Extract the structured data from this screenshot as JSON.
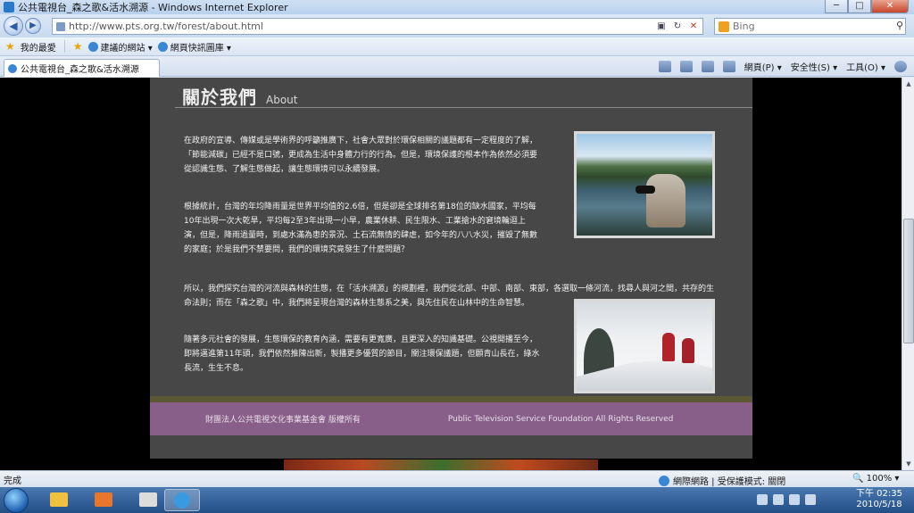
{
  "window": {
    "title": "公共電視台_森之歌&活水溯源 - Windows Internet Explorer",
    "minimize": "─",
    "maximize": "□",
    "close": "✕"
  },
  "address": {
    "url": "http://www.pts.org.tw/forest/about.html"
  },
  "search": {
    "placeholder": "Bing"
  },
  "favorites": {
    "label": "我的最愛",
    "items": [
      {
        "label": "建議的網站 ▾"
      },
      {
        "label": "網頁快訊圖庫 ▾"
      }
    ]
  },
  "tab": {
    "title": "公共電視台_森之歌&活水溯源"
  },
  "commands": {
    "page": "網頁(P) ▾",
    "safety": "安全性(S) ▾",
    "tools": "工具(O) ▾"
  },
  "page": {
    "heading_zh": "關於我們",
    "heading_en": "About",
    "paragraphs": [
      "在政府的宣導、傳媒或是學術界的呼籲推廣下，社會大眾對於環保相關的議題都有一定程度的了解，「節能減碳」已經不是口號，更成為生活中身體力行的行為。但是，環境保護的根本作為依然必須要從認識生態、了解生態做起，讓生態環境可以永續發展。",
      "根據統計，台灣的年均降雨量是世界平均值的2.6倍，但是卻是全球排名第18位的缺水國家，平均每10年出現一次大乾旱，平均每2至3年出現一小旱，農業休耕、民生限水、工業搶水的窘境輪迴上演，但是，降雨過量時，到處水滿為患的景況、土石流無情的肆虐，如今年的八八水災，摧毀了無數的家庭；於是我們不禁要問，我們的環境究竟發生了什麼問題？",
      "所以，我們探究台灣的河流與森林的生態，在「活水溯源」的規劃裡，我們從北部、中部、南部、東部，各選取一條河流，找尋人與河之間，共存的生命法則；而在「森之歌」中，我們將呈現台灣的森林生態系之美，與先住民在山林中的生命智慧。",
      "隨著多元社會的發展，生態環保的教育內涵，需要有更寬廣，且更深入的知識基礎。公視開播至今，即將邁進第11年頭，我們依然推陳出新，製播更多優質的節目，關注環保議題，但願青山長在，綠水長流，生生不息。"
    ],
    "footer_zh": "財團法人公共電視文化事業基金會 版權所有",
    "footer_en": "Public Television Service Foundation  All Rights Reserved"
  },
  "status": {
    "done": "完成",
    "zone": "網際網路 | 受保護模式: 關閉",
    "zoom": "🔍 100% ▾"
  },
  "taskbar": {
    "time": "下午 02:35",
    "date": "2010/5/18"
  }
}
